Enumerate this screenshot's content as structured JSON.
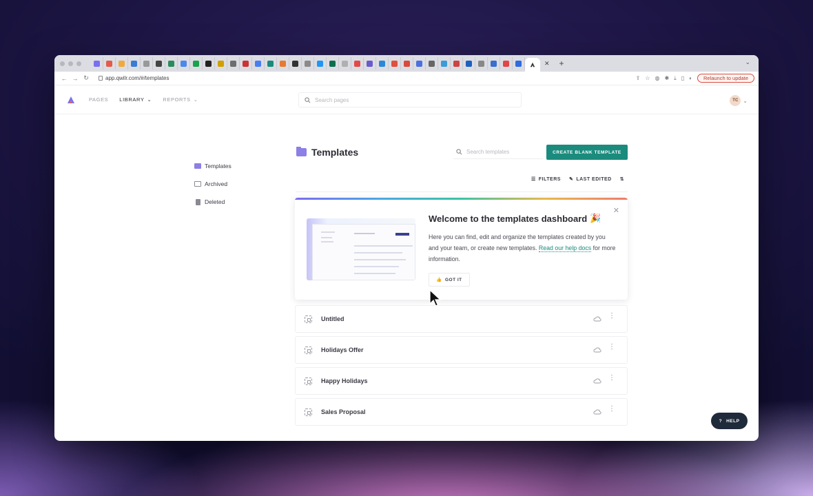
{
  "browser": {
    "url": "app.qwilr.com/#/templates",
    "relaunch_label": "Relaunch to update",
    "active_tab_icon": "qwilr-logo-icon",
    "favicon_colors": [
      "#7a6ff0",
      "#e55b4a",
      "#f2a93b",
      "#3a7bd5",
      "#999999",
      "#444444",
      "#2a8c5a",
      "#4a88ee",
      "#19a34a",
      "#222222",
      "#d0a000",
      "#6e6e6e",
      "#cc3333",
      "#4a7ef0",
      "#1b8b7d",
      "#e87a30",
      "#333333",
      "#8a8a8a",
      "#2196f3",
      "#0d6e4f",
      "#b0b0b0",
      "#e24a4a",
      "#6a5acd",
      "#2b88d8",
      "#e0503c",
      "#d84a3c",
      "#4a6fe0",
      "#666666",
      "#3a9bd8",
      "#cc4444",
      "#1e5fbf",
      "#888888",
      "#3a6ecf",
      "#e04646",
      "#2f6be0"
    ]
  },
  "app": {
    "nav": {
      "pages": "PAGES",
      "library": "LIBRARY",
      "reports": "REPORTS"
    },
    "search_placeholder": "Search pages",
    "avatar_initials": "TC"
  },
  "sidebar": {
    "items": [
      {
        "label": "Templates",
        "icon": "folder-icon"
      },
      {
        "label": "Archived",
        "icon": "archive-icon"
      },
      {
        "label": "Deleted",
        "icon": "trash-icon"
      }
    ]
  },
  "main": {
    "title": "Templates",
    "search_placeholder": "Search templates",
    "create_button": "CREATE BLANK TEMPLATE",
    "filters_label": "FILTERS",
    "sort_label": "LAST EDITED"
  },
  "welcome": {
    "title": "Welcome to the templates dashboard",
    "body_before": "Here you can find, edit and organize the templates created by you and your team, or create new templates.",
    "link": "Read our help docs",
    "body_after": "for more information.",
    "button": "GOT IT",
    "emoji": "🎉"
  },
  "templates": [
    {
      "name": "Untitled"
    },
    {
      "name": "Holidays Offer"
    },
    {
      "name": "Happy Holidays"
    },
    {
      "name": "Sales Proposal"
    }
  ],
  "help_label": "HELP",
  "colors": {
    "accent": "#1b8b7d",
    "folder": "#8c7fe6",
    "help_bg": "#1f2a3a"
  }
}
